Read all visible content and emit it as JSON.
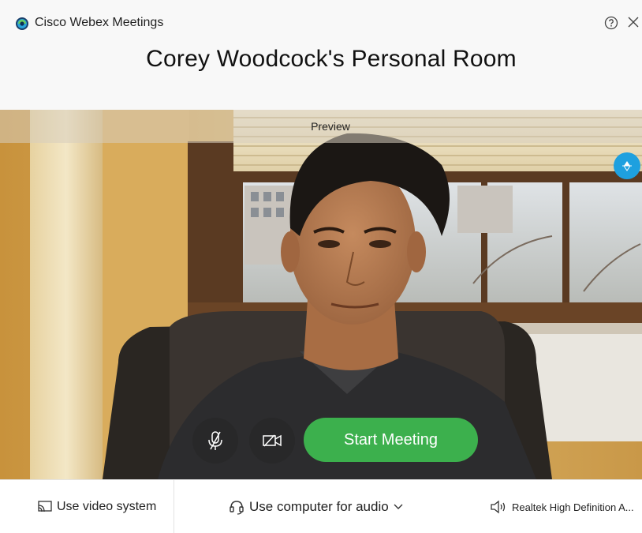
{
  "window": {
    "app_title": "Cisco Webex Meetings",
    "room_title": "Corey Woodcock's Personal Room"
  },
  "preview": {
    "label": "Preview",
    "start_button_label": "Start Meeting"
  },
  "footer": {
    "video_system_label": "Use video system",
    "audio_label": "Use computer for audio",
    "speaker_label": "Realtek High Definition A..."
  },
  "colors": {
    "accent_blue": "#1ea0df",
    "start_green": "#3cb04d",
    "header_bg": "#f8f8f8"
  },
  "icons": {
    "logo": "webex-logo-icon",
    "help": "help-icon",
    "close": "close-icon",
    "layout": "layout-toggle-icon",
    "mute": "microphone-muted-icon",
    "video": "video-off-icon",
    "cast": "cast-icon",
    "headset": "headset-icon",
    "speaker": "speaker-icon"
  }
}
